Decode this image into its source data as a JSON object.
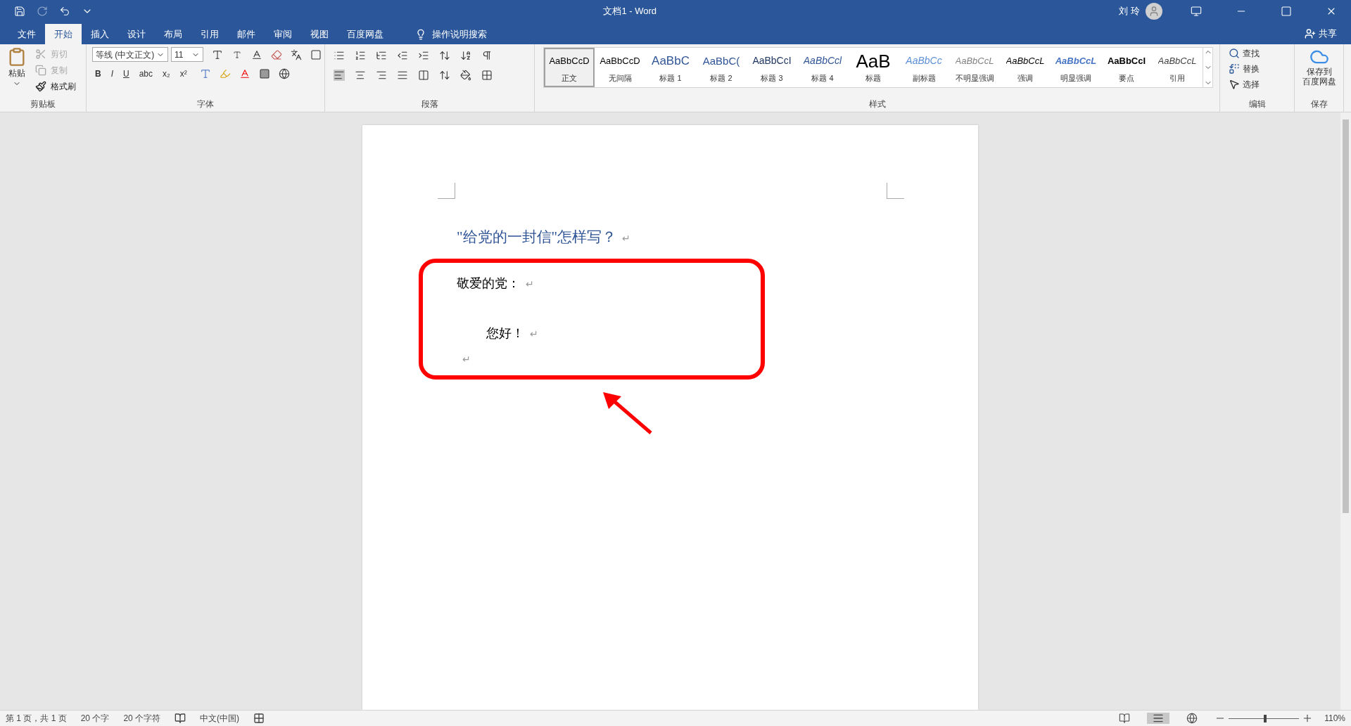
{
  "window": {
    "title": "文档1  -  Word",
    "user": "刘 玲"
  },
  "tabs": [
    {
      "label": "文件",
      "selected": false
    },
    {
      "label": "开始",
      "selected": true
    },
    {
      "label": "插入",
      "selected": false
    },
    {
      "label": "设计",
      "selected": false
    },
    {
      "label": "布局",
      "selected": false
    },
    {
      "label": "引用",
      "selected": false
    },
    {
      "label": "邮件",
      "selected": false
    },
    {
      "label": "审阅",
      "selected": false
    },
    {
      "label": "视图",
      "selected": false
    },
    {
      "label": "百度网盘",
      "selected": false
    }
  ],
  "tell_me": "操作说明搜索",
  "share": "共享",
  "clipboard": {
    "paste": "粘贴",
    "items": [
      {
        "label": "剪切",
        "disabled": true
      },
      {
        "label": "复制",
        "disabled": true
      },
      {
        "label": "格式刷",
        "disabled": false
      }
    ],
    "group": "剪贴板"
  },
  "font": {
    "name": "等线 (中文正文)",
    "size": "11",
    "format_buttons": [
      "B",
      "I",
      "U",
      "abc",
      "x₂",
      "x²"
    ],
    "group": "字体"
  },
  "paragraph": {
    "group": "段落"
  },
  "styles": {
    "group": "样式",
    "items": [
      {
        "preview": "AaBbCcD",
        "name": "正文",
        "kind": "normal",
        "selected": true
      },
      {
        "preview": "AaBbCcD",
        "name": "无间隔",
        "kind": "normal",
        "selected": false
      },
      {
        "preview": "AaBbC",
        "name": "标题 1",
        "kind": "h1",
        "selected": false
      },
      {
        "preview": "AaBbC(",
        "name": "标题 2",
        "kind": "h2",
        "selected": false
      },
      {
        "preview": "AaBbCcI",
        "name": "标题 3",
        "kind": "h3",
        "selected": false
      },
      {
        "preview": "AaBbCcl",
        "name": "标题 4",
        "kind": "h4",
        "selected": false
      },
      {
        "preview": "AaB",
        "name": "标题",
        "kind": "title",
        "selected": false
      },
      {
        "preview": "AaBbCc",
        "name": "副标题",
        "kind": "subtitle",
        "selected": false
      },
      {
        "preview": "AaBbCcL",
        "name": "不明显强调",
        "kind": "subtle",
        "selected": false
      },
      {
        "preview": "AaBbCcL",
        "name": "强调",
        "kind": "emphasis",
        "selected": false
      },
      {
        "preview": "AaBbCcL",
        "name": "明显强调",
        "kind": "intense",
        "selected": false
      },
      {
        "preview": "AaBbCcI",
        "name": "要点",
        "kind": "strong",
        "selected": false
      },
      {
        "preview": "AaBbCcL",
        "name": "引用",
        "kind": "quote",
        "selected": false
      }
    ]
  },
  "editing": {
    "group": "编辑",
    "items": [
      "查找",
      "替换",
      "选择"
    ]
  },
  "save": {
    "group": "保存",
    "lines": [
      "保存到",
      "百度网盘"
    ]
  },
  "document": {
    "paragraphs": [
      {
        "kind": "heading",
        "text": "\"给党的一封信\"怎样写？",
        "mark": "↵"
      },
      {
        "kind": "body",
        "text": "敬爱的党：",
        "mark": "↵"
      },
      {
        "kind": "indent",
        "text": "您好！",
        "mark": "↵"
      },
      {
        "kind": "empty",
        "mark": "↵"
      }
    ]
  },
  "status_bar": {
    "items": [
      "第 1 页，共 1 页",
      "20 个字",
      "20 个字符"
    ],
    "language": "中文(中国)",
    "zoom": "110%",
    "zoom_slider": {
      "level": 0.52
    }
  }
}
